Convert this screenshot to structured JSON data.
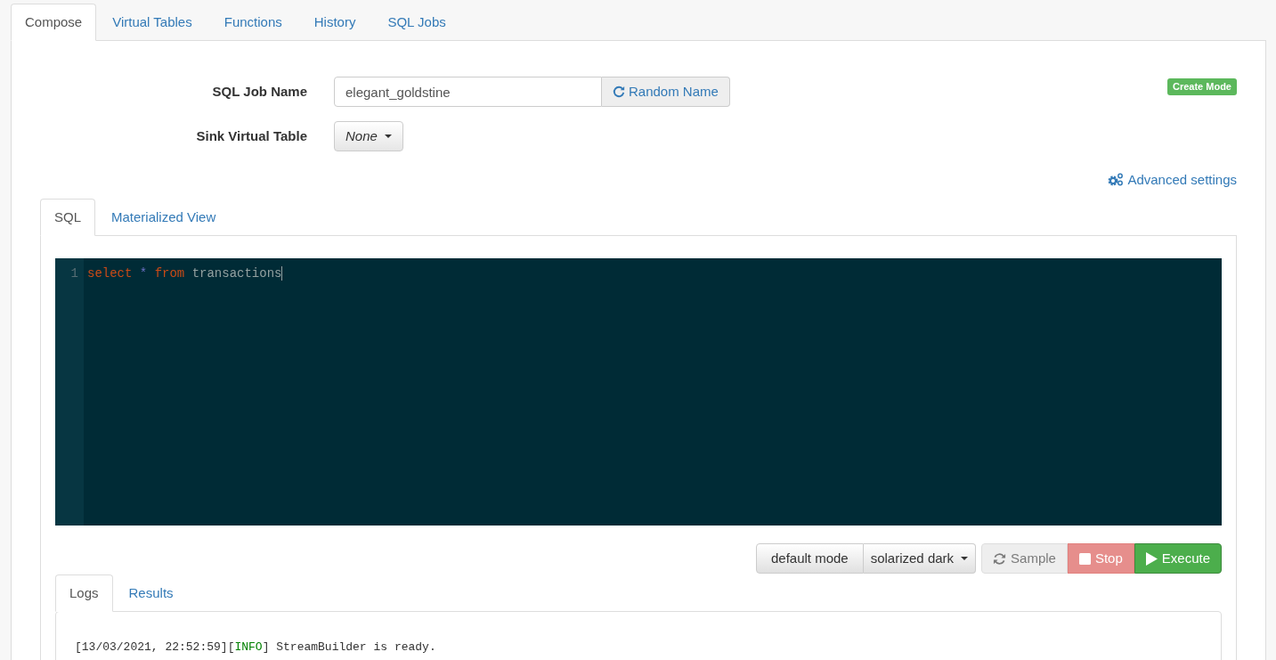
{
  "main_tabs": [
    {
      "label": "Compose",
      "selected": true
    },
    {
      "label": "Virtual Tables",
      "selected": false
    },
    {
      "label": "Functions",
      "selected": false
    },
    {
      "label": "History",
      "selected": false
    },
    {
      "label": "SQL Jobs",
      "selected": false
    }
  ],
  "form": {
    "job_name_label": "SQL Job Name",
    "job_name_value": "elegant_goldstine",
    "random_name_button": "Random Name",
    "sink_label": "Sink Virtual Table",
    "sink_value": "None"
  },
  "mode_badge": "Create Mode",
  "advanced_settings": "Advanced settings",
  "editor_tabs": [
    {
      "label": "SQL",
      "selected": true
    },
    {
      "label": "Materialized View",
      "selected": false
    }
  ],
  "editor": {
    "line_number": "1",
    "tokens": [
      {
        "kind": "keyword",
        "text": "select"
      },
      {
        "kind": "operator",
        "text": "*"
      },
      {
        "kind": "keyword",
        "text": "from"
      },
      {
        "kind": "identifier",
        "text": "transactions"
      }
    ]
  },
  "toolbar": {
    "mode_button": "default mode",
    "theme_dropdown": "solarized dark",
    "actions": [
      {
        "kind": "sample",
        "label": "Sample",
        "disabled": true
      },
      {
        "kind": "stop",
        "label": "Stop",
        "disabled": true
      },
      {
        "kind": "execute",
        "label": "Execute",
        "disabled": false
      }
    ]
  },
  "output_tabs": [
    {
      "label": "Logs",
      "selected": true
    },
    {
      "label": "Results",
      "selected": false
    }
  ],
  "logs": [
    {
      "timestamp": "[13/03/2021, 22:52:59][",
      "level": "INFO",
      "message": "] StreamBuilder is ready."
    }
  ]
}
